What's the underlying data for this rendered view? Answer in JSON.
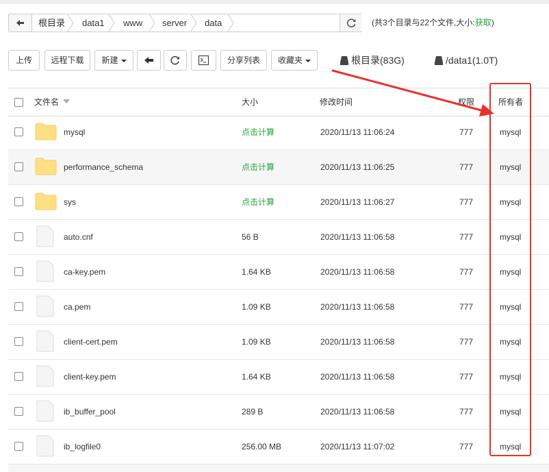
{
  "address_bar": {
    "breadcrumbs": [
      "根目录",
      "data1",
      "www",
      "server",
      "data"
    ]
  },
  "summary": {
    "text": "(共3个目录与22个文件,大小:",
    "link": "获取",
    "suffix": ")"
  },
  "toolbar": {
    "upload": "上传",
    "remote_download": "远程下载",
    "new": "新建",
    "share_list": "分享列表",
    "favorites": "收藏夹"
  },
  "disks": [
    {
      "label": "根目录(83G)"
    },
    {
      "label": "/data1(1.0T)"
    }
  ],
  "table": {
    "headers": {
      "name": "文件名",
      "size": "大小",
      "modified": "修改时间",
      "permission": "权限",
      "owner": "所有者"
    },
    "rows": [
      {
        "name": "mysql",
        "type": "folder",
        "size": "点击计算",
        "modified": "2020/11/13 11:06:24",
        "permission": "777",
        "owner": "mysql"
      },
      {
        "name": "performance_schema",
        "type": "folder",
        "size": "点击计算",
        "modified": "2020/11/13 11:06:25",
        "permission": "777",
        "owner": "mysql"
      },
      {
        "name": "sys",
        "type": "folder",
        "size": "点击计算",
        "modified": "2020/11/13 11:06:27",
        "permission": "777",
        "owner": "mysql"
      },
      {
        "name": "auto.cnf",
        "type": "file",
        "size": "56 B",
        "modified": "2020/11/13 11:06:58",
        "permission": "777",
        "owner": "mysql"
      },
      {
        "name": "ca-key.pem",
        "type": "file",
        "size": "1.64 KB",
        "modified": "2020/11/13 11:06:58",
        "permission": "777",
        "owner": "mysql"
      },
      {
        "name": "ca.pem",
        "type": "file",
        "size": "1.09 KB",
        "modified": "2020/11/13 11:06:58",
        "permission": "777",
        "owner": "mysql"
      },
      {
        "name": "client-cert.pem",
        "type": "file",
        "size": "1.09 KB",
        "modified": "2020/11/13 11:06:58",
        "permission": "777",
        "owner": "mysql"
      },
      {
        "name": "client-key.pem",
        "type": "file",
        "size": "1.64 KB",
        "modified": "2020/11/13 11:06:58",
        "permission": "777",
        "owner": "mysql"
      },
      {
        "name": "ib_buffer_pool",
        "type": "file",
        "size": "289 B",
        "modified": "2020/11/13 11:06:58",
        "permission": "777",
        "owner": "mysql"
      },
      {
        "name": "ib_logfile0",
        "type": "file",
        "size": "256.00 MB",
        "modified": "2020/11/13 11:07:02",
        "permission": "777",
        "owner": "mysql"
      }
    ]
  },
  "colors": {
    "accent_green": "#20a53a",
    "annotation_red": "#e8312a",
    "folder_yellow": "#fde084"
  },
  "icons": {
    "back": "arrow-left-icon",
    "refresh": "refresh-icon",
    "terminal": "terminal-icon",
    "disk": "disk-icon",
    "folder": "folder-icon",
    "file": "file-icon",
    "sort": "sort-down-icon"
  }
}
